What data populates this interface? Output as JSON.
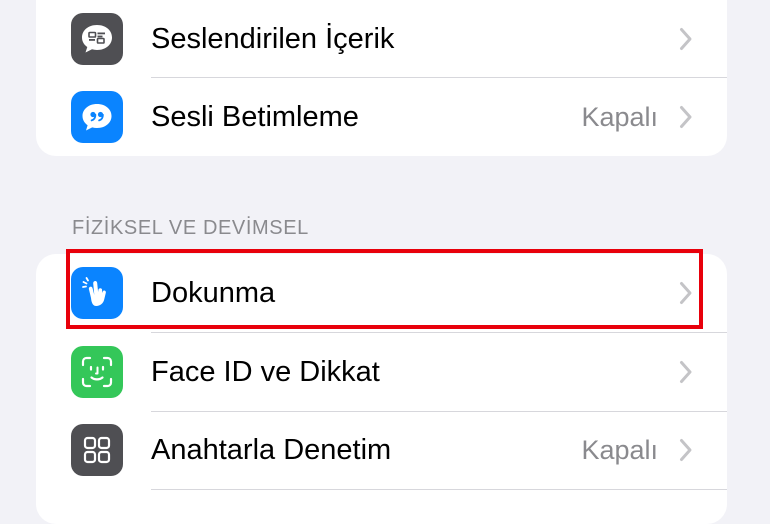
{
  "colors": {
    "background": "#f2f2f7",
    "card": "#ffffff",
    "gray_icon": "#4f4f53",
    "blue_icon": "#0a84ff",
    "green_icon": "#34c759",
    "highlight": "#e8000b"
  },
  "group1": {
    "rows": [
      {
        "label": "Seslendirilen İçerik",
        "icon": "spoken-content-icon"
      },
      {
        "label": "Sesli Betimleme",
        "value": "Kapalı",
        "icon": "audio-description-icon"
      }
    ]
  },
  "section": {
    "header": "FİZİKSEL VE DEVİMSEL"
  },
  "group2": {
    "rows": [
      {
        "label": "Dokunma",
        "icon": "touch-hand-icon"
      },
      {
        "label": "Face ID ve Dikkat",
        "icon": "face-id-icon"
      },
      {
        "label": "Anahtarla Denetim",
        "value": "Kapalı",
        "icon": "switch-control-icon"
      }
    ]
  }
}
